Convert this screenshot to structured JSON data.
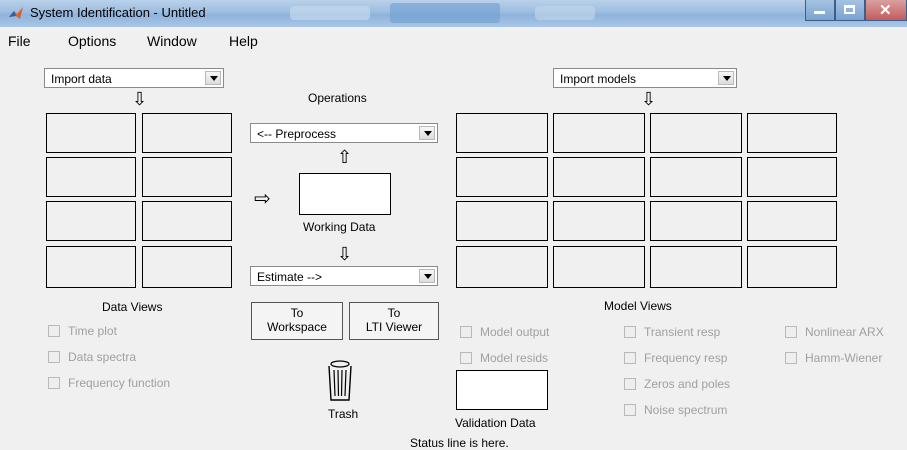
{
  "window": {
    "title": "System Identification - Untitled"
  },
  "menu": [
    "File",
    "Options",
    "Window",
    "Help"
  ],
  "data_panel": {
    "import_select": "Import data",
    "views_label": "Data Views"
  },
  "operations": {
    "label": "Operations",
    "preprocess_select": "<-- Preprocess",
    "working_data_label": "Working Data",
    "estimate_select": "Estimate -->"
  },
  "buttons": {
    "to_workspace": [
      "To",
      "Workspace"
    ],
    "to_lti_viewer": [
      "To",
      "LTI Viewer"
    ]
  },
  "trash": {
    "label": "Trash"
  },
  "models_panel": {
    "import_select": "Import models",
    "views_label": "Model Views"
  },
  "data_views": [
    "Time plot",
    "Data spectra",
    "Frequency function"
  ],
  "model_views": {
    "col1": [
      "Model output",
      "Model resids"
    ],
    "col2": [
      "Transient resp",
      "Frequency resp",
      "Zeros and poles",
      "Noise spectrum"
    ],
    "col3": [
      "Nonlinear ARX",
      "Hamm-Wiener"
    ]
  },
  "validation": {
    "label": "Validation Data"
  },
  "status": {
    "text": "Status line is here."
  }
}
